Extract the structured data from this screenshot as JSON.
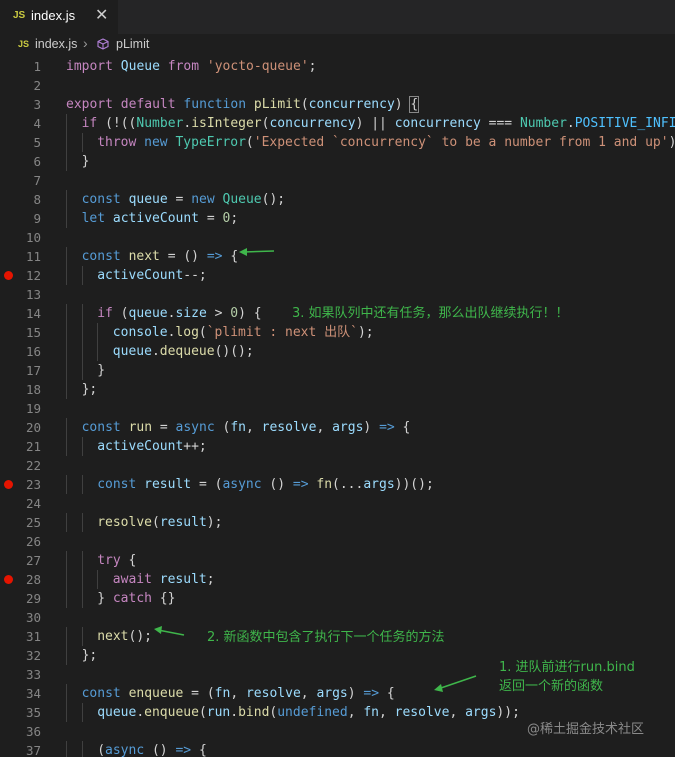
{
  "tab": {
    "icon": "JS",
    "name": "index.js",
    "close": "✕"
  },
  "breadcrumb": {
    "icon": "JS",
    "file": "index.js",
    "separator": "›",
    "symbol": "pLimit"
  },
  "lines": [
    {
      "n": "1",
      "bp": false,
      "indent": 0,
      "tokens": [
        [
          "import",
          "ctl"
        ],
        [
          " "
        ],
        [
          "Queue",
          "var"
        ],
        [
          " "
        ],
        [
          "from",
          "ctl"
        ],
        [
          " "
        ],
        [
          "'yocto-queue'",
          "str"
        ],
        [
          ";"
        ]
      ]
    },
    {
      "n": "2",
      "bp": false,
      "indent": 0,
      "tokens": []
    },
    {
      "n": "3",
      "bp": false,
      "indent": 0,
      "tokens": [
        [
          "export",
          "ctl"
        ],
        [
          " "
        ],
        [
          "default",
          "ctl"
        ],
        [
          " "
        ],
        [
          "function",
          "kw"
        ],
        [
          " "
        ],
        [
          "pLimit",
          "fn"
        ],
        [
          "("
        ],
        [
          "concurrency",
          "var"
        ],
        [
          ") "
        ],
        [
          "{",
          "bkt"
        ]
      ]
    },
    {
      "n": "4",
      "bp": false,
      "indent": 1,
      "tokens": [
        [
          "if",
          "ctl"
        ],
        [
          " (!(("
        ],
        [
          "Number",
          "cls"
        ],
        [
          "."
        ],
        [
          "isInteger",
          "fn"
        ],
        [
          "("
        ],
        [
          "concurrency",
          "var"
        ],
        [
          ") || "
        ],
        [
          "concurrency",
          "var"
        ],
        [
          " === "
        ],
        [
          "Number",
          "cls"
        ],
        [
          "."
        ],
        [
          "POSITIVE_INFINITY",
          "const"
        ],
        [
          "))"
        ]
      ]
    },
    {
      "n": "5",
      "bp": false,
      "indent": 2,
      "tokens": [
        [
          "throw",
          "ctl"
        ],
        [
          " "
        ],
        [
          "new",
          "kw"
        ],
        [
          " "
        ],
        [
          "TypeError",
          "cls"
        ],
        [
          "("
        ],
        [
          "'Expected `concurrency` to be a number from 1 and up'",
          "str"
        ],
        [
          ");"
        ]
      ]
    },
    {
      "n": "6",
      "bp": false,
      "indent": 1,
      "tokens": [
        [
          "}"
        ]
      ]
    },
    {
      "n": "7",
      "bp": false,
      "indent": 0,
      "tokens": []
    },
    {
      "n": "8",
      "bp": false,
      "indent": 1,
      "tokens": [
        [
          "const",
          "kw"
        ],
        [
          " "
        ],
        [
          "queue",
          "var"
        ],
        [
          " = "
        ],
        [
          "new",
          "kw"
        ],
        [
          " "
        ],
        [
          "Queue",
          "cls"
        ],
        [
          "();"
        ]
      ]
    },
    {
      "n": "9",
      "bp": false,
      "indent": 1,
      "tokens": [
        [
          "let",
          "kw"
        ],
        [
          " "
        ],
        [
          "activeCount",
          "var"
        ],
        [
          " = "
        ],
        [
          "0",
          "num"
        ],
        [
          ";"
        ]
      ]
    },
    {
      "n": "10",
      "bp": false,
      "indent": 0,
      "tokens": []
    },
    {
      "n": "11",
      "bp": false,
      "indent": 1,
      "tokens": [
        [
          "const",
          "kw"
        ],
        [
          " "
        ],
        [
          "next",
          "fn"
        ],
        [
          " = () "
        ],
        [
          "=>",
          "kw"
        ],
        [
          " {"
        ]
      ]
    },
    {
      "n": "12",
      "bp": true,
      "indent": 2,
      "tokens": [
        [
          "activeCount",
          "var"
        ],
        [
          "--;"
        ]
      ]
    },
    {
      "n": "13",
      "bp": false,
      "indent": 0,
      "tokens": []
    },
    {
      "n": "14",
      "bp": false,
      "indent": 2,
      "tokens": [
        [
          "if",
          "ctl"
        ],
        [
          " ("
        ],
        [
          "queue",
          "var"
        ],
        [
          "."
        ],
        [
          "size",
          "var"
        ],
        [
          " > "
        ],
        [
          "0",
          "num"
        ],
        [
          ") {"
        ]
      ]
    },
    {
      "n": "15",
      "bp": false,
      "indent": 3,
      "tokens": [
        [
          "console",
          "var"
        ],
        [
          "."
        ],
        [
          "log",
          "fn"
        ],
        [
          "("
        ],
        [
          "`plimit : next 出队`",
          "str"
        ],
        [
          ");"
        ]
      ]
    },
    {
      "n": "16",
      "bp": false,
      "indent": 3,
      "tokens": [
        [
          "queue",
          "var"
        ],
        [
          "."
        ],
        [
          "dequeue",
          "fn"
        ],
        [
          "()();"
        ]
      ]
    },
    {
      "n": "17",
      "bp": false,
      "indent": 2,
      "tokens": [
        [
          "}"
        ]
      ]
    },
    {
      "n": "18",
      "bp": false,
      "indent": 1,
      "tokens": [
        [
          "};"
        ]
      ]
    },
    {
      "n": "19",
      "bp": false,
      "indent": 0,
      "tokens": []
    },
    {
      "n": "20",
      "bp": false,
      "indent": 1,
      "tokens": [
        [
          "const",
          "kw"
        ],
        [
          " "
        ],
        [
          "run",
          "fn"
        ],
        [
          " = "
        ],
        [
          "async",
          "kw"
        ],
        [
          " ("
        ],
        [
          "fn",
          "var"
        ],
        [
          ", "
        ],
        [
          "resolve",
          "var"
        ],
        [
          ", "
        ],
        [
          "args",
          "var"
        ],
        [
          ") "
        ],
        [
          "=>",
          "kw"
        ],
        [
          " {"
        ]
      ]
    },
    {
      "n": "21",
      "bp": false,
      "indent": 2,
      "tokens": [
        [
          "activeCount",
          "var"
        ],
        [
          "++;"
        ]
      ]
    },
    {
      "n": "22",
      "bp": false,
      "indent": 0,
      "tokens": []
    },
    {
      "n": "23",
      "bp": true,
      "indent": 2,
      "tokens": [
        [
          "const",
          "kw"
        ],
        [
          " "
        ],
        [
          "result",
          "var"
        ],
        [
          " = ("
        ],
        [
          "async",
          "kw"
        ],
        [
          " () "
        ],
        [
          "=>",
          "kw"
        ],
        [
          " "
        ],
        [
          "fn",
          "fn"
        ],
        [
          "(..."
        ],
        [
          "args",
          "var"
        ],
        [
          "))();"
        ]
      ]
    },
    {
      "n": "24",
      "bp": false,
      "indent": 0,
      "tokens": []
    },
    {
      "n": "25",
      "bp": false,
      "indent": 2,
      "tokens": [
        [
          "resolve",
          "fn"
        ],
        [
          "("
        ],
        [
          "result",
          "var"
        ],
        [
          ");"
        ]
      ]
    },
    {
      "n": "26",
      "bp": false,
      "indent": 0,
      "tokens": []
    },
    {
      "n": "27",
      "bp": false,
      "indent": 2,
      "tokens": [
        [
          "try",
          "ctl"
        ],
        [
          " {"
        ]
      ]
    },
    {
      "n": "28",
      "bp": true,
      "indent": 3,
      "tokens": [
        [
          "await",
          "ctl"
        ],
        [
          " "
        ],
        [
          "result",
          "var"
        ],
        [
          ";"
        ]
      ]
    },
    {
      "n": "29",
      "bp": false,
      "indent": 2,
      "tokens": [
        [
          "} "
        ],
        [
          "catch",
          "ctl"
        ],
        [
          " {}"
        ]
      ]
    },
    {
      "n": "30",
      "bp": false,
      "indent": 0,
      "tokens": []
    },
    {
      "n": "31",
      "bp": false,
      "indent": 2,
      "tokens": [
        [
          "next",
          "fn"
        ],
        [
          "();"
        ]
      ]
    },
    {
      "n": "32",
      "bp": false,
      "indent": 1,
      "tokens": [
        [
          "};"
        ]
      ]
    },
    {
      "n": "33",
      "bp": false,
      "indent": 0,
      "tokens": []
    },
    {
      "n": "34",
      "bp": false,
      "indent": 1,
      "tokens": [
        [
          "const",
          "kw"
        ],
        [
          " "
        ],
        [
          "enqueue",
          "fn"
        ],
        [
          " = ("
        ],
        [
          "fn",
          "var"
        ],
        [
          ", "
        ],
        [
          "resolve",
          "var"
        ],
        [
          ", "
        ],
        [
          "args",
          "var"
        ],
        [
          ") "
        ],
        [
          "=>",
          "kw"
        ],
        [
          " {"
        ]
      ]
    },
    {
      "n": "35",
      "bp": false,
      "indent": 2,
      "tokens": [
        [
          "queue",
          "var"
        ],
        [
          "."
        ],
        [
          "enqueue",
          "fn"
        ],
        [
          "("
        ],
        [
          "run",
          "var"
        ],
        [
          "."
        ],
        [
          "bind",
          "fn"
        ],
        [
          "("
        ],
        [
          "undefined",
          "kw"
        ],
        [
          ", "
        ],
        [
          "fn",
          "var"
        ],
        [
          ", "
        ],
        [
          "resolve",
          "var"
        ],
        [
          ", "
        ],
        [
          "args",
          "var"
        ],
        [
          "));"
        ]
      ]
    },
    {
      "n": "36",
      "bp": false,
      "indent": 0,
      "tokens": []
    },
    {
      "n": "37",
      "bp": false,
      "indent": 2,
      "tokens": [
        [
          "("
        ],
        [
          "async",
          "kw"
        ],
        [
          " () "
        ],
        [
          "=>",
          "kw"
        ],
        [
          " {"
        ]
      ]
    }
  ],
  "annotations": {
    "note3": "3. 如果队列中还有任务，那么出队继续执行！！",
    "note2": "2. 新函数中包含了执行下一个任务的方法",
    "note1_line1": "1. 进队前进行run.bind",
    "note1_line2": "返回一个新的函数"
  },
  "watermark": "@稀土掘金技术社区",
  "colors": {
    "annotation": "#3fb64b",
    "breakpoint": "#e51400",
    "background": "#1e1e1e"
  }
}
